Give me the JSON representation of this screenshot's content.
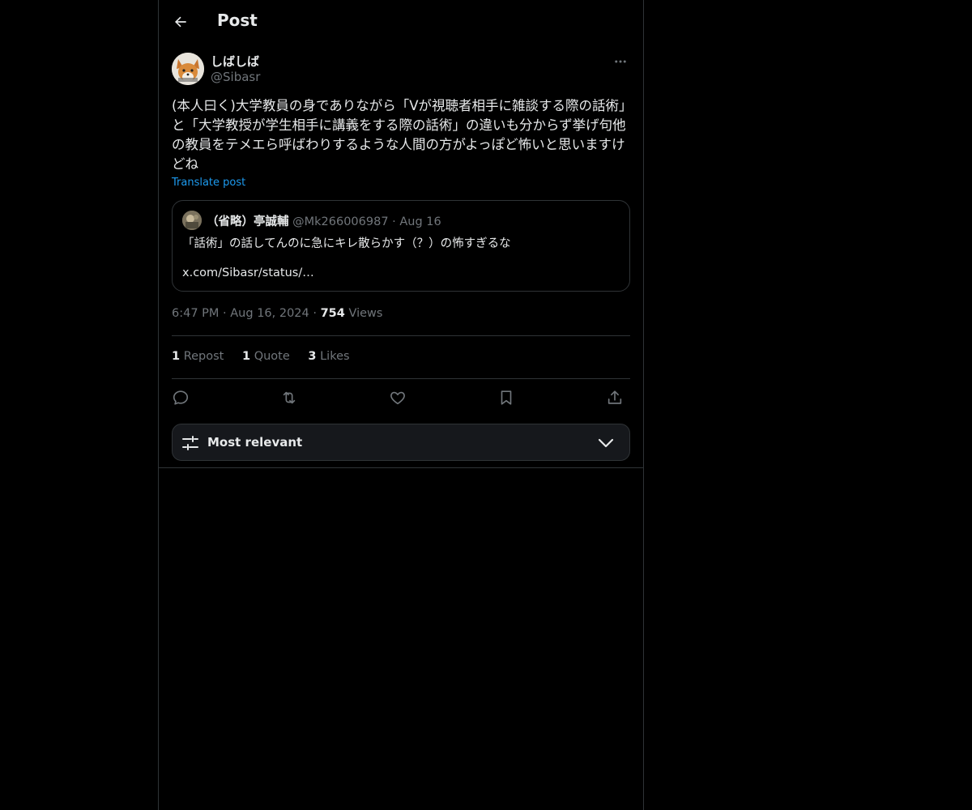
{
  "header": {
    "title": "Post",
    "back_icon": "arrow-left-icon"
  },
  "author": {
    "display_name": "しばしば",
    "handle": "@Sibasr",
    "avatar_icon": "fox-avatar",
    "more_icon": "ellipsis-icon"
  },
  "post": {
    "text": "(本人曰く)大学教員の身でありながら「Vが視聴者相手に雑談する際の話術」と「大学教授が学生相手に講義をする際の話術」の違いも分からず挙げ句他の教員をテメエら呼ばわりするような人間の方がよっぽど怖いと思いますけどね",
    "translate_label": "Translate post"
  },
  "quote": {
    "display_name": "（省略）亭誠輔",
    "handle": "@Mk266006987",
    "separator": "·",
    "date": "Aug 16",
    "text": "「話術」の話してんのに急にキレ散らかす（？）の怖すぎるな",
    "link": "x.com/Sibasr/status/…"
  },
  "meta": {
    "time": "6:47 PM",
    "separator": "·",
    "date": "Aug 16, 2024",
    "views_count": "754",
    "views_label": "Views"
  },
  "stats": {
    "reposts_count": "1",
    "reposts_label": "Repost",
    "quotes_count": "1",
    "quotes_label": "Quote",
    "likes_count": "3",
    "likes_label": "Likes"
  },
  "actions": {
    "reply_icon": "reply-icon",
    "repost_icon": "repost-icon",
    "like_icon": "heart-icon",
    "bookmark_icon": "bookmark-icon",
    "share_icon": "share-icon"
  },
  "sort": {
    "label": "Most relevant",
    "icon": "sliders-icon",
    "chevron": "chevron-down-icon"
  },
  "colors": {
    "background": "#000000",
    "text_primary": "#e7e9ea",
    "text_secondary": "#71767b",
    "accent_link": "#1d9bf0",
    "border": "#2f3336"
  }
}
